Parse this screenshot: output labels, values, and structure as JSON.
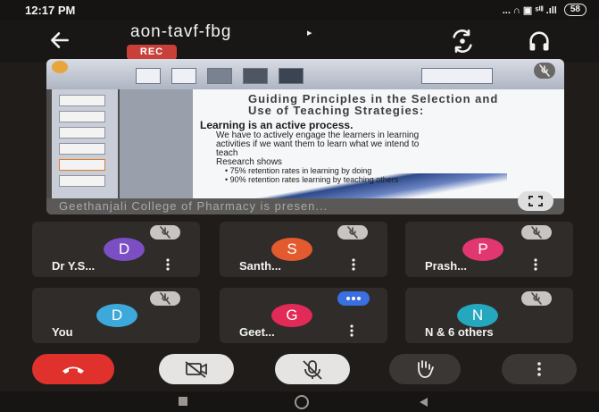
{
  "status_bar": {
    "time": "12:17 PM",
    "icons_text": "... ∩ ▣ ˢⁱˡˡ .ıll",
    "battery": "58"
  },
  "header": {
    "meeting_code": "aon-tavf-fbg",
    "caret": "▸",
    "rec_label": "REC",
    "icons": [
      "back-arrow-icon",
      "switch-camera-icon",
      "headphones-icon"
    ]
  },
  "presentation": {
    "slide_title_line1": "Guiding Principles in the Selection and",
    "slide_title_line2": "Use of Teaching Strategies:",
    "bullets": [
      "Learning is an active process.",
      "We have to actively engage the learners in learning",
      "activities if we want them to learn what we intend to",
      "teach",
      "Research shows",
      "• 75% retention rates in learning by doing",
      "• 90% retention rates learning by teaching others"
    ],
    "caption": "Geethanjali College of Pharmacy is presen..."
  },
  "participants": [
    {
      "initial": "D",
      "name": "Dr Y.S...",
      "color": "#7b4fc3"
    },
    {
      "initial": "S",
      "name": "Santh...",
      "color": "#e25a2e"
    },
    {
      "initial": "P",
      "name": "Prash...",
      "color": "#e23670"
    },
    {
      "initial": "D",
      "name": "You",
      "color": "#3da9db"
    },
    {
      "initial": "G",
      "name": "Geet...",
      "color": "#e12a57"
    },
    {
      "initial": "N",
      "name": "N & 6 others",
      "color": "#25a7bd"
    }
  ],
  "controls": [
    "end-call-button",
    "camera-off-button",
    "mic-off-button",
    "raise-hand-button",
    "more-options-button"
  ],
  "colors": {
    "end_call": "#e0312c",
    "toggle_bg": "#e6e4e2",
    "dark_btn": "#3a3735"
  }
}
